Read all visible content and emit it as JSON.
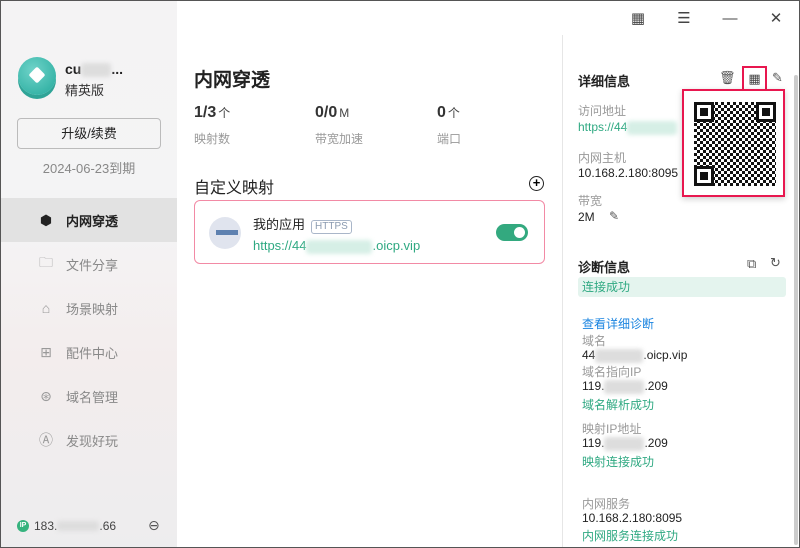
{
  "window": {
    "icons": [
      "qrcode-icon",
      "menu-icon",
      "minimize-icon",
      "close-icon"
    ]
  },
  "sidebar": {
    "username": "cu",
    "username_suffix": "...",
    "plan": "精英版",
    "upgrade_label": "升级/续费",
    "expiry": "2024-06-23到期",
    "items": [
      {
        "label": "内网穿透",
        "icon": "cube-icon",
        "active": true
      },
      {
        "label": "文件分享",
        "icon": "folder-share-icon"
      },
      {
        "label": "场景映射",
        "icon": "scene-icon"
      },
      {
        "label": "配件中心",
        "icon": "apps-icon"
      },
      {
        "label": "域名管理",
        "icon": "domain-icon"
      },
      {
        "label": "发现好玩",
        "icon": "discover-icon"
      }
    ],
    "ip_badge": "IP",
    "ip_prefix": "183.",
    "ip_suffix": ".66"
  },
  "main": {
    "title": "内网穿透",
    "stats": [
      {
        "value": "1/3",
        "unit": "个",
        "label": "映射数"
      },
      {
        "value": "0/0",
        "unit": "M",
        "label": "带宽加速"
      },
      {
        "value": "0",
        "unit": "个",
        "label": "端口"
      }
    ],
    "section_title": "自定义映射",
    "mapping": {
      "name": "我的应用",
      "tag": "HTTPS",
      "url_prefix": "https://44",
      "url_suffix": ".oicp.vip",
      "enabled": true
    }
  },
  "details": {
    "title": "详细信息",
    "access_label": "访问地址",
    "access_value": "https://44",
    "host_label": "内网主机",
    "host_value": "10.168.2.180:8095",
    "bw_label": "带宽",
    "bw_value": "2M"
  },
  "diag": {
    "title": "诊断信息",
    "status": "连接成功",
    "detail_link": "查看详细诊断",
    "domain_label": "域名",
    "domain_prefix": "44",
    "domain_suffix": ".oicp.vip",
    "dip_label": "域名指向IP",
    "dip_prefix": "119.",
    "dip_suffix": ".209",
    "dip_status": "域名解析成功",
    "mip_label": "映射IP地址",
    "mip_prefix": "119.",
    "mip_suffix": ".209",
    "mip_status": "映射连接成功",
    "svc_label": "内网服务",
    "svc_value": "10.168.2.180:8095",
    "svc_status": "内网服务连接成功"
  },
  "colors": {
    "accent": "#2fa982",
    "highlight": "#e8174f",
    "link": "#1a84e0"
  }
}
